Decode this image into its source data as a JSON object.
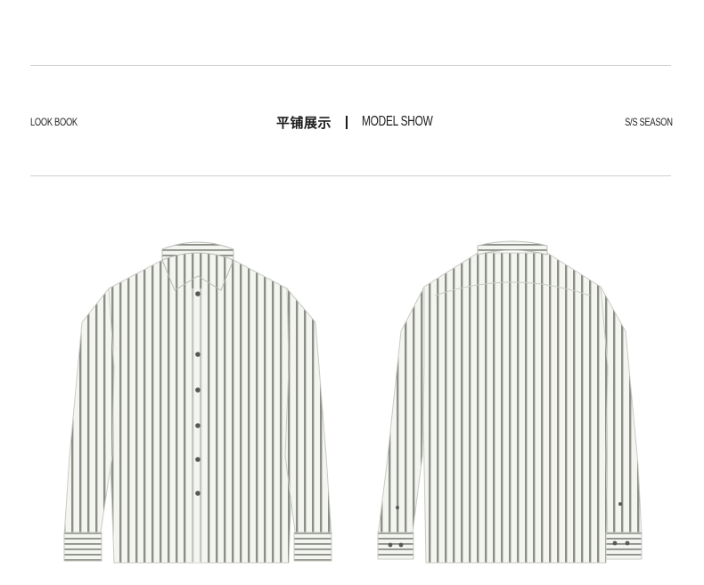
{
  "header": {
    "left_label": "LOOK BOOK",
    "cn_title": "平铺展示",
    "en_title": "MODEL SHOW",
    "right_label": "S/S SEASON"
  },
  "colors": {
    "stripe": "#8a8f87",
    "shirt_base": "#f4f5f1",
    "button": "#555a58",
    "rule": "#cfcfcf"
  },
  "images": {
    "front_icon": "striped-shirt-front",
    "back_icon": "striped-shirt-back"
  }
}
